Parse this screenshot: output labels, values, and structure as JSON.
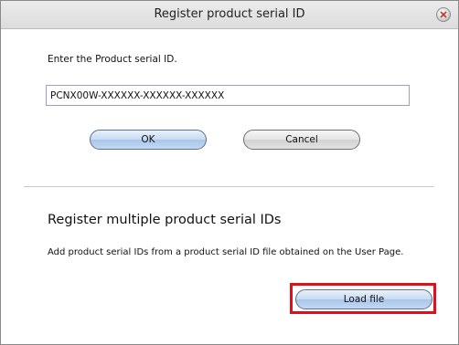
{
  "window": {
    "title": "Register product serial ID"
  },
  "single": {
    "prompt": "Enter the Product serial ID.",
    "serial_value": "PCNX00W-XXXXXX-XXXXXX-XXXXXX",
    "ok_label": "OK",
    "cancel_label": "Cancel"
  },
  "multiple": {
    "heading": "Register multiple product serial IDs",
    "description": "Add product serial IDs from a product serial ID file obtained on the User Page.",
    "load_file_label": "Load file"
  },
  "icons": {
    "close": "close-icon"
  },
  "colors": {
    "highlight": "#e0101a",
    "input_border": "#9c9ad8",
    "primary_button": "#c6daf2"
  }
}
